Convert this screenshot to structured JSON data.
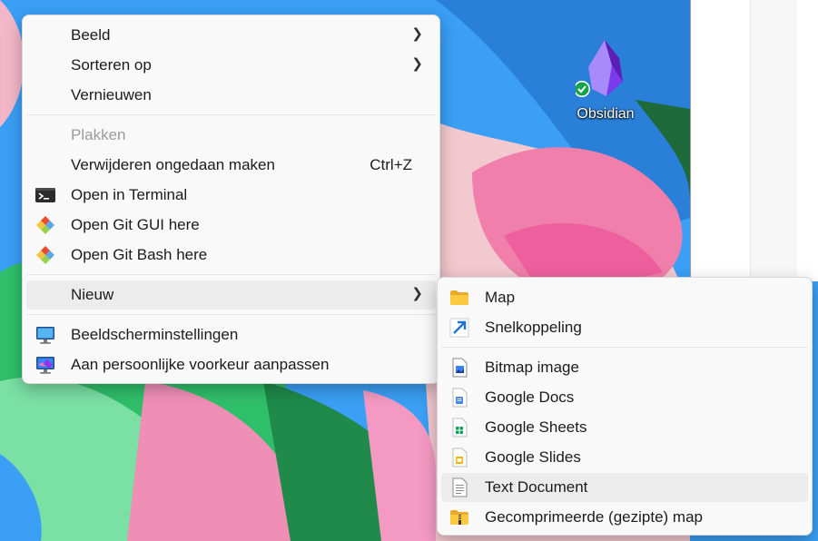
{
  "desktop": {
    "icons": [
      {
        "label": "Obsidian",
        "icon": "obsidian-icon"
      }
    ]
  },
  "context_menu": {
    "items": [
      {
        "label": "Beeld",
        "submenu": true
      },
      {
        "label": "Sorteren op",
        "submenu": true
      },
      {
        "label": "Vernieuwen"
      },
      {
        "label": "Plakken",
        "disabled": true
      },
      {
        "label": "Verwijderen ongedaan maken",
        "shortcut": "Ctrl+Z"
      },
      {
        "label": "Open in Terminal",
        "icon": "terminal-icon"
      },
      {
        "label": "Open Git GUI here",
        "icon": "git-icon"
      },
      {
        "label": "Open Git Bash here",
        "icon": "git-icon"
      },
      {
        "label": "Nieuw",
        "submenu": true,
        "highlighted": true
      },
      {
        "label": "Beeldscherminstellingen",
        "icon": "display-settings-icon"
      },
      {
        "label": "Aan persoonlijke voorkeur aanpassen",
        "icon": "personalize-icon"
      }
    ]
  },
  "new_submenu": {
    "items": [
      {
        "label": "Map",
        "icon": "folder-icon"
      },
      {
        "label": "Snelkoppeling",
        "icon": "shortcut-arrow-icon"
      },
      {
        "label": "Bitmap image",
        "icon": "bitmap-image-icon"
      },
      {
        "label": "Google Docs",
        "icon": "google-docs-icon",
        "color": "#4285f4"
      },
      {
        "label": "Google Sheets",
        "icon": "google-sheets-icon",
        "color": "#0f9d58"
      },
      {
        "label": "Google Slides",
        "icon": "google-slides-icon",
        "color": "#f4b400"
      },
      {
        "label": "Text Document",
        "icon": "text-document-icon",
        "highlighted": true
      },
      {
        "label": "Gecomprimeerde (gezipte) map",
        "icon": "zip-folder-icon"
      }
    ]
  }
}
